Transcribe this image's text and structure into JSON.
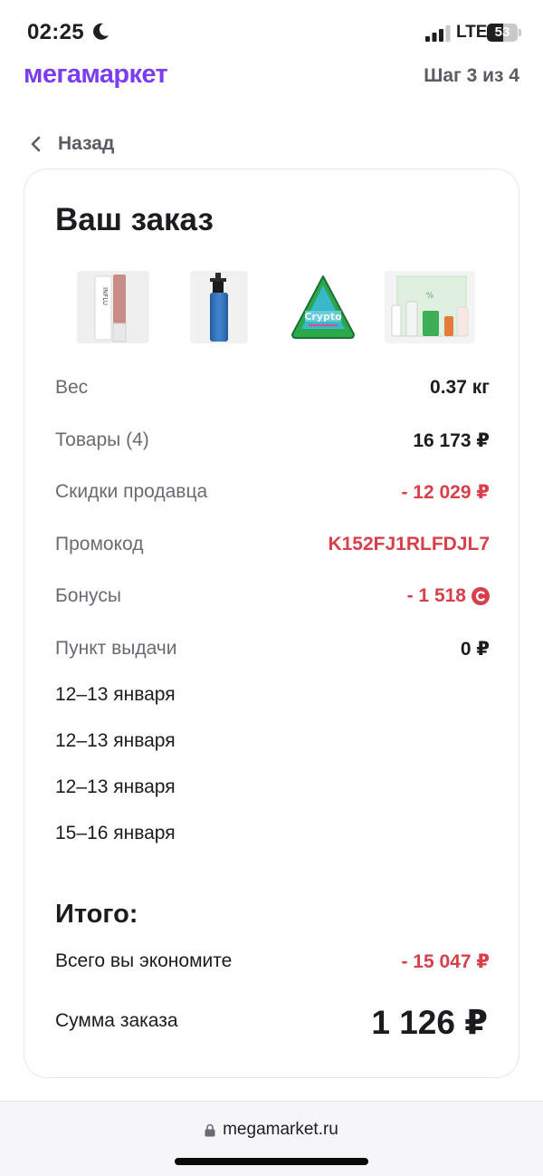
{
  "status_bar": {
    "time": "02:25",
    "network": "LTE",
    "battery_level": "53",
    "battery_fraction": 0.53
  },
  "header": {
    "logo": "мегамаркет",
    "step": "Шаг 3 из 4",
    "back_label": "Назад"
  },
  "order": {
    "title": "Ваш заказ",
    "products": [
      {
        "icon": "lipstick-product-image"
      },
      {
        "icon": "blue-bottle-product-image"
      },
      {
        "icon": "crypto-triangle-product-image"
      },
      {
        "icon": "skincare-set-product-image"
      }
    ],
    "rows": [
      {
        "label": "Вес",
        "value": "0.37 кг",
        "accent": false
      },
      {
        "label": "Товары (4)",
        "value": "16 173 ₽",
        "accent": false
      },
      {
        "label": "Скидки продавца",
        "value": "- 12 029 ₽",
        "accent": true
      },
      {
        "label": "Промокод",
        "value": "K152FJ1RLFDJL7",
        "accent": true
      },
      {
        "label": "Бонусы",
        "value": "- 1 518",
        "accent": true
      },
      {
        "label": "Пункт выдачи",
        "value": "0 ₽",
        "accent": false
      }
    ],
    "delivery_dates": [
      "12–13 января",
      "12–13 января",
      "12–13 января",
      "15–16 января"
    ],
    "total": {
      "title": "Итого:",
      "savings_label": "Всего вы экономите",
      "savings_value": "- 15 047 ₽",
      "sum_label": "Сумма заказа",
      "sum_value": "1 126 ₽"
    }
  },
  "browser": {
    "url": "megamarket.ru"
  },
  "colors": {
    "brand": "#7a3df0",
    "accent_red": "#d7404a",
    "muted_text": "#6a6a72"
  }
}
